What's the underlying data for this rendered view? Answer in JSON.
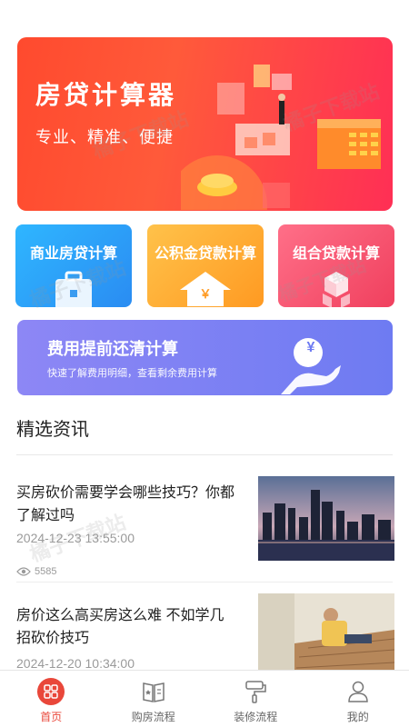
{
  "hero": {
    "title": "房贷计算器",
    "subtitle": "专业、精准、便捷"
  },
  "calculators": [
    {
      "label": "商业房贷计算"
    },
    {
      "label": "公积金贷款计算"
    },
    {
      "label": "组合贷款计算"
    }
  ],
  "prepay": {
    "title": "费用提前还清计算",
    "subtitle": "快速了解费用明细，查看剩余费用计算",
    "icon_char": "¥"
  },
  "section": {
    "title": "精选资讯"
  },
  "news": [
    {
      "title": "买房砍价需要学会哪些技巧？你都了解过吗",
      "date": "2024-12-23 13:55:00",
      "views": "5585"
    },
    {
      "title": "房价这么高买房这么难 不如学几招砍价技巧",
      "date": "2024-12-20 10:34:00"
    }
  ],
  "tabs": [
    {
      "label": "首页",
      "icon": "home-grid-icon",
      "active": true
    },
    {
      "label": "购房流程",
      "icon": "book-icon",
      "active": false
    },
    {
      "label": "装修流程",
      "icon": "paint-roller-icon",
      "active": false
    },
    {
      "label": "我的",
      "icon": "user-icon",
      "active": false
    }
  ],
  "colors": {
    "accent": "#e9473a",
    "hero_start": "#ff4a2e",
    "hero_end": "#ff2f55"
  },
  "watermark": "橘子下载站",
  "card_icon_char": "￥"
}
